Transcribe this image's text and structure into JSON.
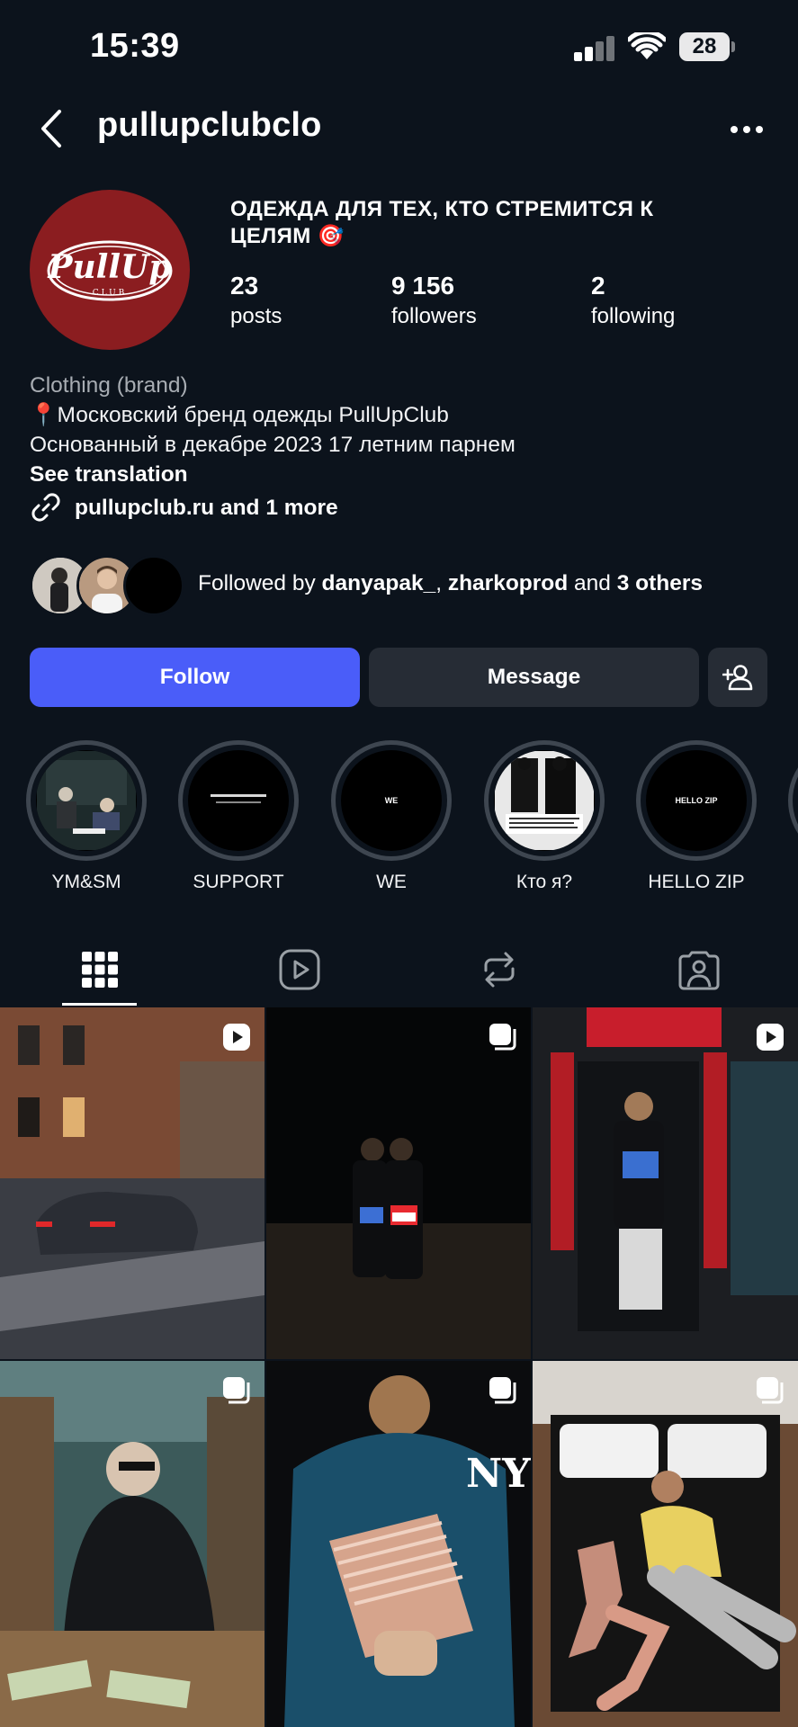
{
  "status_bar": {
    "time": "15:39",
    "battery": "28"
  },
  "header": {
    "username": "pullupclubclo"
  },
  "profile": {
    "avatar_text": "PullUp",
    "avatar_sub": "CLUB",
    "display_name": "ОДЕЖДА ДЛЯ ТЕХ, КТО СТРЕМИТСЯ К ЦЕЛЯМ 🎯",
    "stats": [
      {
        "num": "23",
        "label": "posts"
      },
      {
        "num": "9 156",
        "label": "followers"
      },
      {
        "num": "2",
        "label": "following"
      }
    ],
    "category": "Clothing (brand)",
    "bio_line_1": "📍Московский бренд одежды PullUpClub",
    "bio_line_2": "Основанный в декабре 2023 17 летним парнем",
    "see_translation": "See translation",
    "link": "pullupclub.ru and 1 more"
  },
  "followed_by": {
    "prefix": "Followed by ",
    "user1": "danyapak_",
    "sep": ", ",
    "user2": "zharkoprod",
    "and": " and ",
    "others": "3 others"
  },
  "actions": {
    "follow": "Follow",
    "message": "Message"
  },
  "highlights": [
    {
      "label": "YM&SM",
      "inner": ""
    },
    {
      "label": "SUPPORT",
      "inner": ""
    },
    {
      "label": "WE",
      "inner": "WE"
    },
    {
      "label": "Кто я?",
      "inner": ""
    },
    {
      "label": "HELLO ZIP",
      "inner": "HELLO ZIP"
    }
  ],
  "tabs": [
    "grid-icon",
    "reels-icon",
    "reposts-icon",
    "tagged-icon"
  ],
  "posts": [
    {
      "type": "reel"
    },
    {
      "type": "carousel"
    },
    {
      "type": "reel"
    },
    {
      "type": "carousel"
    },
    {
      "type": "carousel"
    },
    {
      "type": "carousel"
    }
  ],
  "colors": {
    "background": "#0c131c",
    "follow_button": "#4a5df9",
    "secondary_button": "#262c35",
    "avatar_red": "#8b1d20"
  }
}
